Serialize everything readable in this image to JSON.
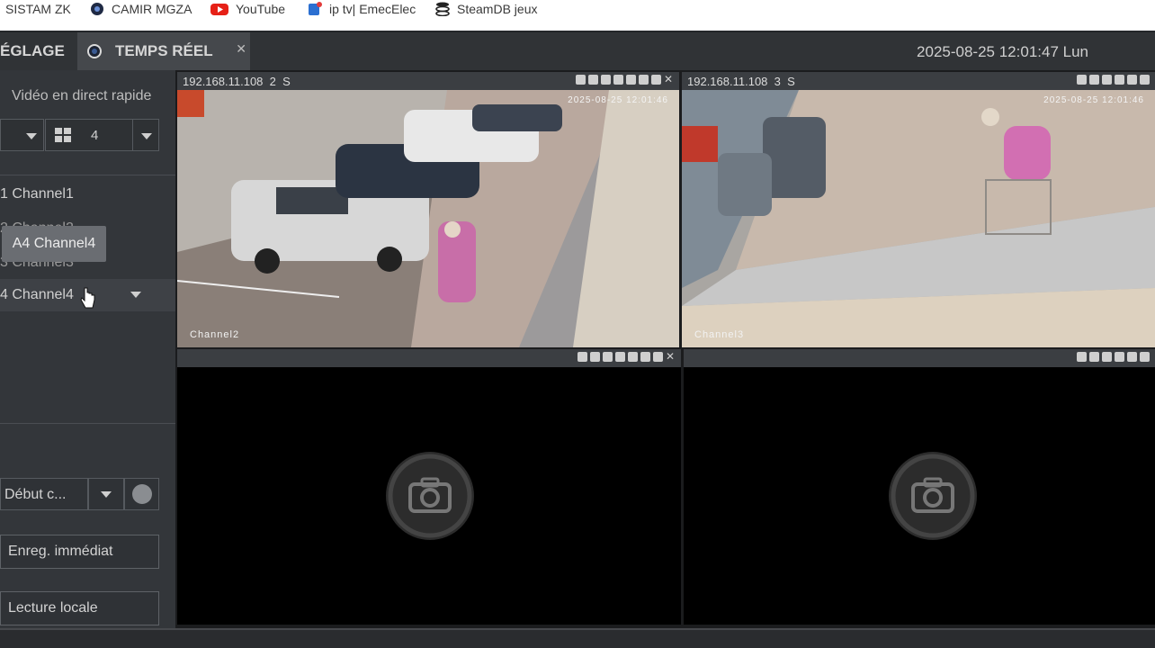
{
  "bookmarks": [
    {
      "label": "SISTAM ZK",
      "icon": "none"
    },
    {
      "label": "CAMIR MGZA",
      "icon": "camir-icon"
    },
    {
      "label": "YouTube",
      "icon": "youtube-icon"
    },
    {
      "label": "ip tv| EmecElec",
      "icon": "iptv-icon"
    },
    {
      "label": "SteamDB jeux",
      "icon": "steamdb-icon"
    }
  ],
  "tabs": {
    "settings_label": "ÉGLAGE",
    "live_label": "TEMPS RÉEL",
    "close_symbol": "✕"
  },
  "header": {
    "datetime": "2025-08-25 12:01:47 Lun"
  },
  "sidebar": {
    "title": "Vidéo en direct rapide",
    "layout_value": "4",
    "channels": [
      {
        "label": "1 Channel1"
      },
      {
        "label": "2 Channel2"
      },
      {
        "label": "3 Channel3"
      },
      {
        "label": "4 Channel4"
      }
    ],
    "tooltip": "A4 Channel4",
    "record_select": "Début c...",
    "record_now_button": "Enreg. immédiat",
    "local_playback_button": "Lecture locale"
  },
  "cells": [
    {
      "ip": "192.168.11.108",
      "channel_no": "2",
      "stream": "S",
      "overlay_name": "Channel2",
      "overlay_time": "2025-08-25 12:01:46",
      "state": "live"
    },
    {
      "ip": "192.168.11.108",
      "channel_no": "3",
      "stream": "S",
      "overlay_name": "Channel3",
      "overlay_time": "2025-08-25 12:01:46",
      "state": "live"
    },
    {
      "ip": "",
      "channel_no": "",
      "stream": "",
      "overlay_name": "",
      "overlay_time": "",
      "state": "no-video"
    },
    {
      "ip": "",
      "channel_no": "",
      "stream": "",
      "overlay_name": "",
      "overlay_time": "",
      "state": "no-video"
    }
  ],
  "colors": {
    "accent": "#4a7ec8",
    "panel_bg": "#33363a",
    "tab_active": "#45484c",
    "grid_bg": "#1b1c1e"
  }
}
